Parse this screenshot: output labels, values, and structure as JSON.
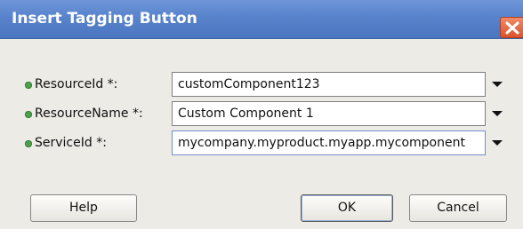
{
  "dialog": {
    "title": "Insert Tagging Button",
    "close_icon": "close-icon"
  },
  "fields": [
    {
      "label": "ResourceId *:",
      "value": "customComponent123"
    },
    {
      "label": "ResourceName *:",
      "value": "Custom Component 1"
    },
    {
      "label": "ServiceId *:",
      "value": "mycompany.myproduct.myapp.mycomponent"
    }
  ],
  "buttons": {
    "help": "Help",
    "ok": "OK",
    "cancel": "Cancel"
  },
  "colors": {
    "titlebar": "#5a84cc",
    "required_bullet": "#4da24d",
    "close": "#d9542d"
  }
}
